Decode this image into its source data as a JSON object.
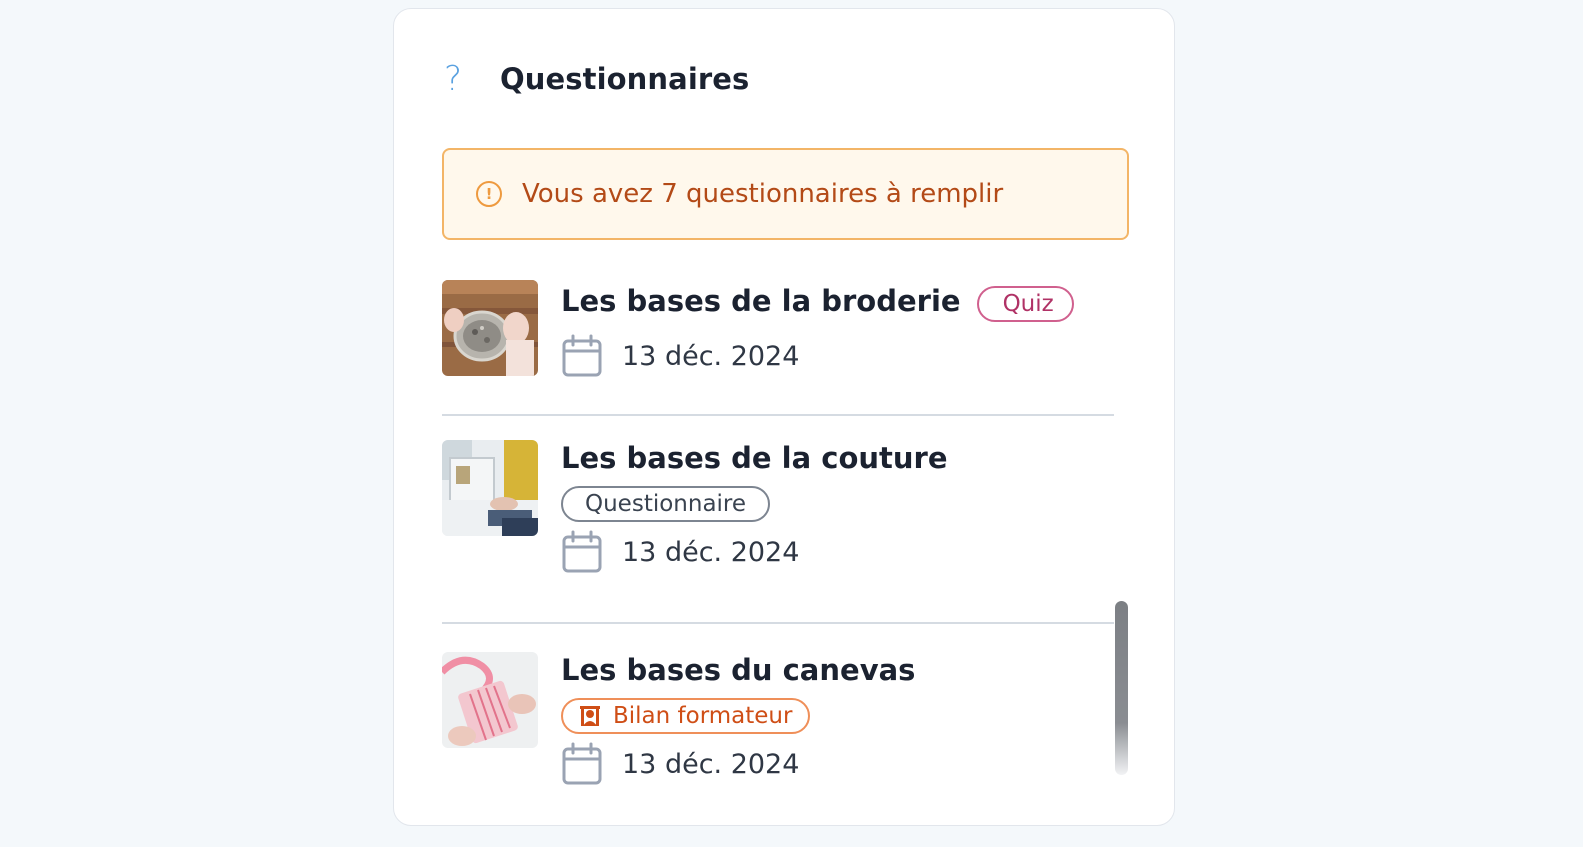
{
  "header": {
    "icon": "question-mark-icon",
    "title": "Questionnaires"
  },
  "alert": {
    "icon": "exclamation-circle-icon",
    "text": "Vous avez 7 questionnaires à remplir",
    "colors": {
      "background": "#fff8ec",
      "border": "#f3b567",
      "text": "#b34a17"
    }
  },
  "items": [
    {
      "title": "Les bases de la broderie",
      "badge": {
        "label": "Quiz",
        "type": "quiz",
        "color": "#b03266"
      },
      "date": "13 déc. 2024",
      "thumbnail": "embroidery-photo"
    },
    {
      "title": "Les bases de la couture",
      "badge": {
        "label": "Questionnaire",
        "type": "questionnaire",
        "color": "#3a4350"
      },
      "date": "13 déc. 2024",
      "thumbnail": "sewing-machine-photo"
    },
    {
      "title": "Les bases du canevas",
      "badge": {
        "label": "Bilan formateur",
        "type": "trainer-review",
        "icon": "teacher-icon",
        "color": "#cf4e16"
      },
      "date": "13 déc. 2024",
      "thumbnail": "canvas-ribbon-photo"
    }
  ]
}
